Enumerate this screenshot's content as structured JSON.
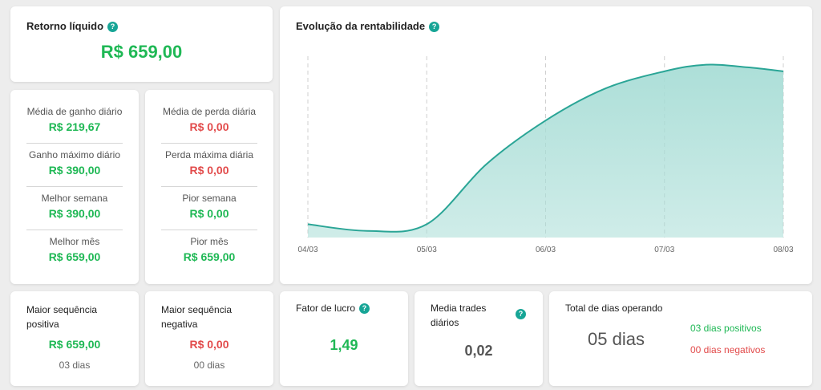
{
  "retorno": {
    "title": "Retorno líquido",
    "value": "R$ 659,00"
  },
  "ganhos": [
    {
      "label": "Média de ganho diário",
      "value": "R$ 219,67"
    },
    {
      "label": "Ganho máximo diário",
      "value": "R$ 390,00"
    },
    {
      "label": "Melhor semana",
      "value": "R$ 390,00"
    },
    {
      "label": "Melhor mês",
      "value": "R$ 659,00"
    }
  ],
  "perdas": [
    {
      "label": "Média de perda diária",
      "value": "R$ 0,00"
    },
    {
      "label": "Perda máxima diária",
      "value": "R$ 0,00"
    },
    {
      "label": "Pior semana",
      "value": "R$ 0,00"
    },
    {
      "label": "Pior mês",
      "value": "R$ 659,00"
    }
  ],
  "seq_positiva": {
    "title_line1": "Maior sequência",
    "title_line2": "positiva",
    "value": "R$ 659,00",
    "days": "03 dias"
  },
  "seq_negativa": {
    "title_line1": "Maior sequência",
    "title_line2": "negativa",
    "value": "R$ 0,00",
    "days": "00 dias"
  },
  "fator_lucro": {
    "title": "Fator de lucro",
    "value": "1,49"
  },
  "media_trades": {
    "title_line1": "Media trades",
    "title_line2": "diários",
    "value": "0,02"
  },
  "total_dias": {
    "title": "Total de dias operando",
    "value": "05 dias",
    "positivos": "03 dias positivos",
    "negativos": "00 dias negativos"
  },
  "colors": {
    "positive": "#1fb855",
    "negative": "#e24b4b",
    "accent": "#17a596",
    "area_fill": "#a8ddd6",
    "line": "#2aa596"
  },
  "icons": {
    "help": "help-circle-icon"
  },
  "chart_data": {
    "type": "area",
    "title": "Evolução da rentabilidade",
    "categories": [
      "04/03",
      "05/03",
      "06/03",
      "07/03",
      "08/03"
    ],
    "x": [
      0,
      0.5,
      1,
      1.5,
      2,
      2.5,
      3,
      3.35,
      3.7,
      4
    ],
    "values": [
      10,
      5,
      10,
      55,
      88,
      112,
      125,
      130,
      128,
      125
    ],
    "xlabel": "",
    "ylabel": "",
    "ylim": [
      0,
      140
    ],
    "grid": "vertical-dashed",
    "legend": "none"
  }
}
